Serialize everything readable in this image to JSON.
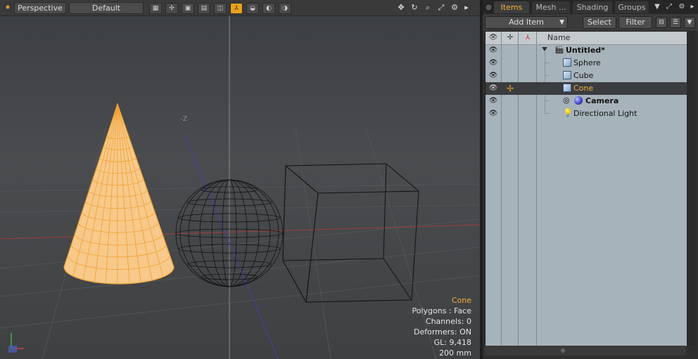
{
  "viewport": {
    "view_mode": "Perspective",
    "shading_mode": "Default",
    "axis_label": "-Z",
    "icons": [
      "checker-icon",
      "pattern-icon",
      "square-icon",
      "stack-icon",
      "panel-icon",
      "vertex-icon",
      "pot-icon",
      "scroll-icon",
      "lathe-icon"
    ],
    "tools": [
      "move-icon",
      "rotate-icon",
      "zoom-icon",
      "maximize-icon",
      "gear-icon",
      "play-icon"
    ],
    "info": {
      "selection": "Cone",
      "polygons": "Polygons : Face",
      "channels": "Channels: 0",
      "deformers": "Deformers: ON",
      "gl": "GL: 9,418",
      "scale": "200 mm"
    }
  },
  "panel": {
    "tabs": [
      {
        "label": "Items",
        "active": true
      },
      {
        "label": "Mesh ...",
        "active": false
      },
      {
        "label": "Shading",
        "active": false
      },
      {
        "label": "Groups",
        "active": false
      }
    ],
    "add_item": "Add Item",
    "select": "Select",
    "filter": "Filter",
    "column_name": "Name",
    "items": [
      {
        "label": "Untitled*",
        "type": "scene",
        "bold": true,
        "selected": false
      },
      {
        "label": "Sphere",
        "type": "mesh",
        "bold": false,
        "selected": false
      },
      {
        "label": "Cube",
        "type": "mesh",
        "bold": false,
        "selected": false
      },
      {
        "label": "Cone",
        "type": "mesh",
        "bold": false,
        "selected": true
      },
      {
        "label": "Camera",
        "type": "camera",
        "bold": true,
        "selected": false
      },
      {
        "label": "Directional Light",
        "type": "light",
        "bold": false,
        "selected": false
      }
    ]
  },
  "colors": {
    "accent": "#f2b13c",
    "selection_wire": "#f0a030",
    "grid_x_axis": "#a04040",
    "grid_z_axis": "#4040b0"
  }
}
